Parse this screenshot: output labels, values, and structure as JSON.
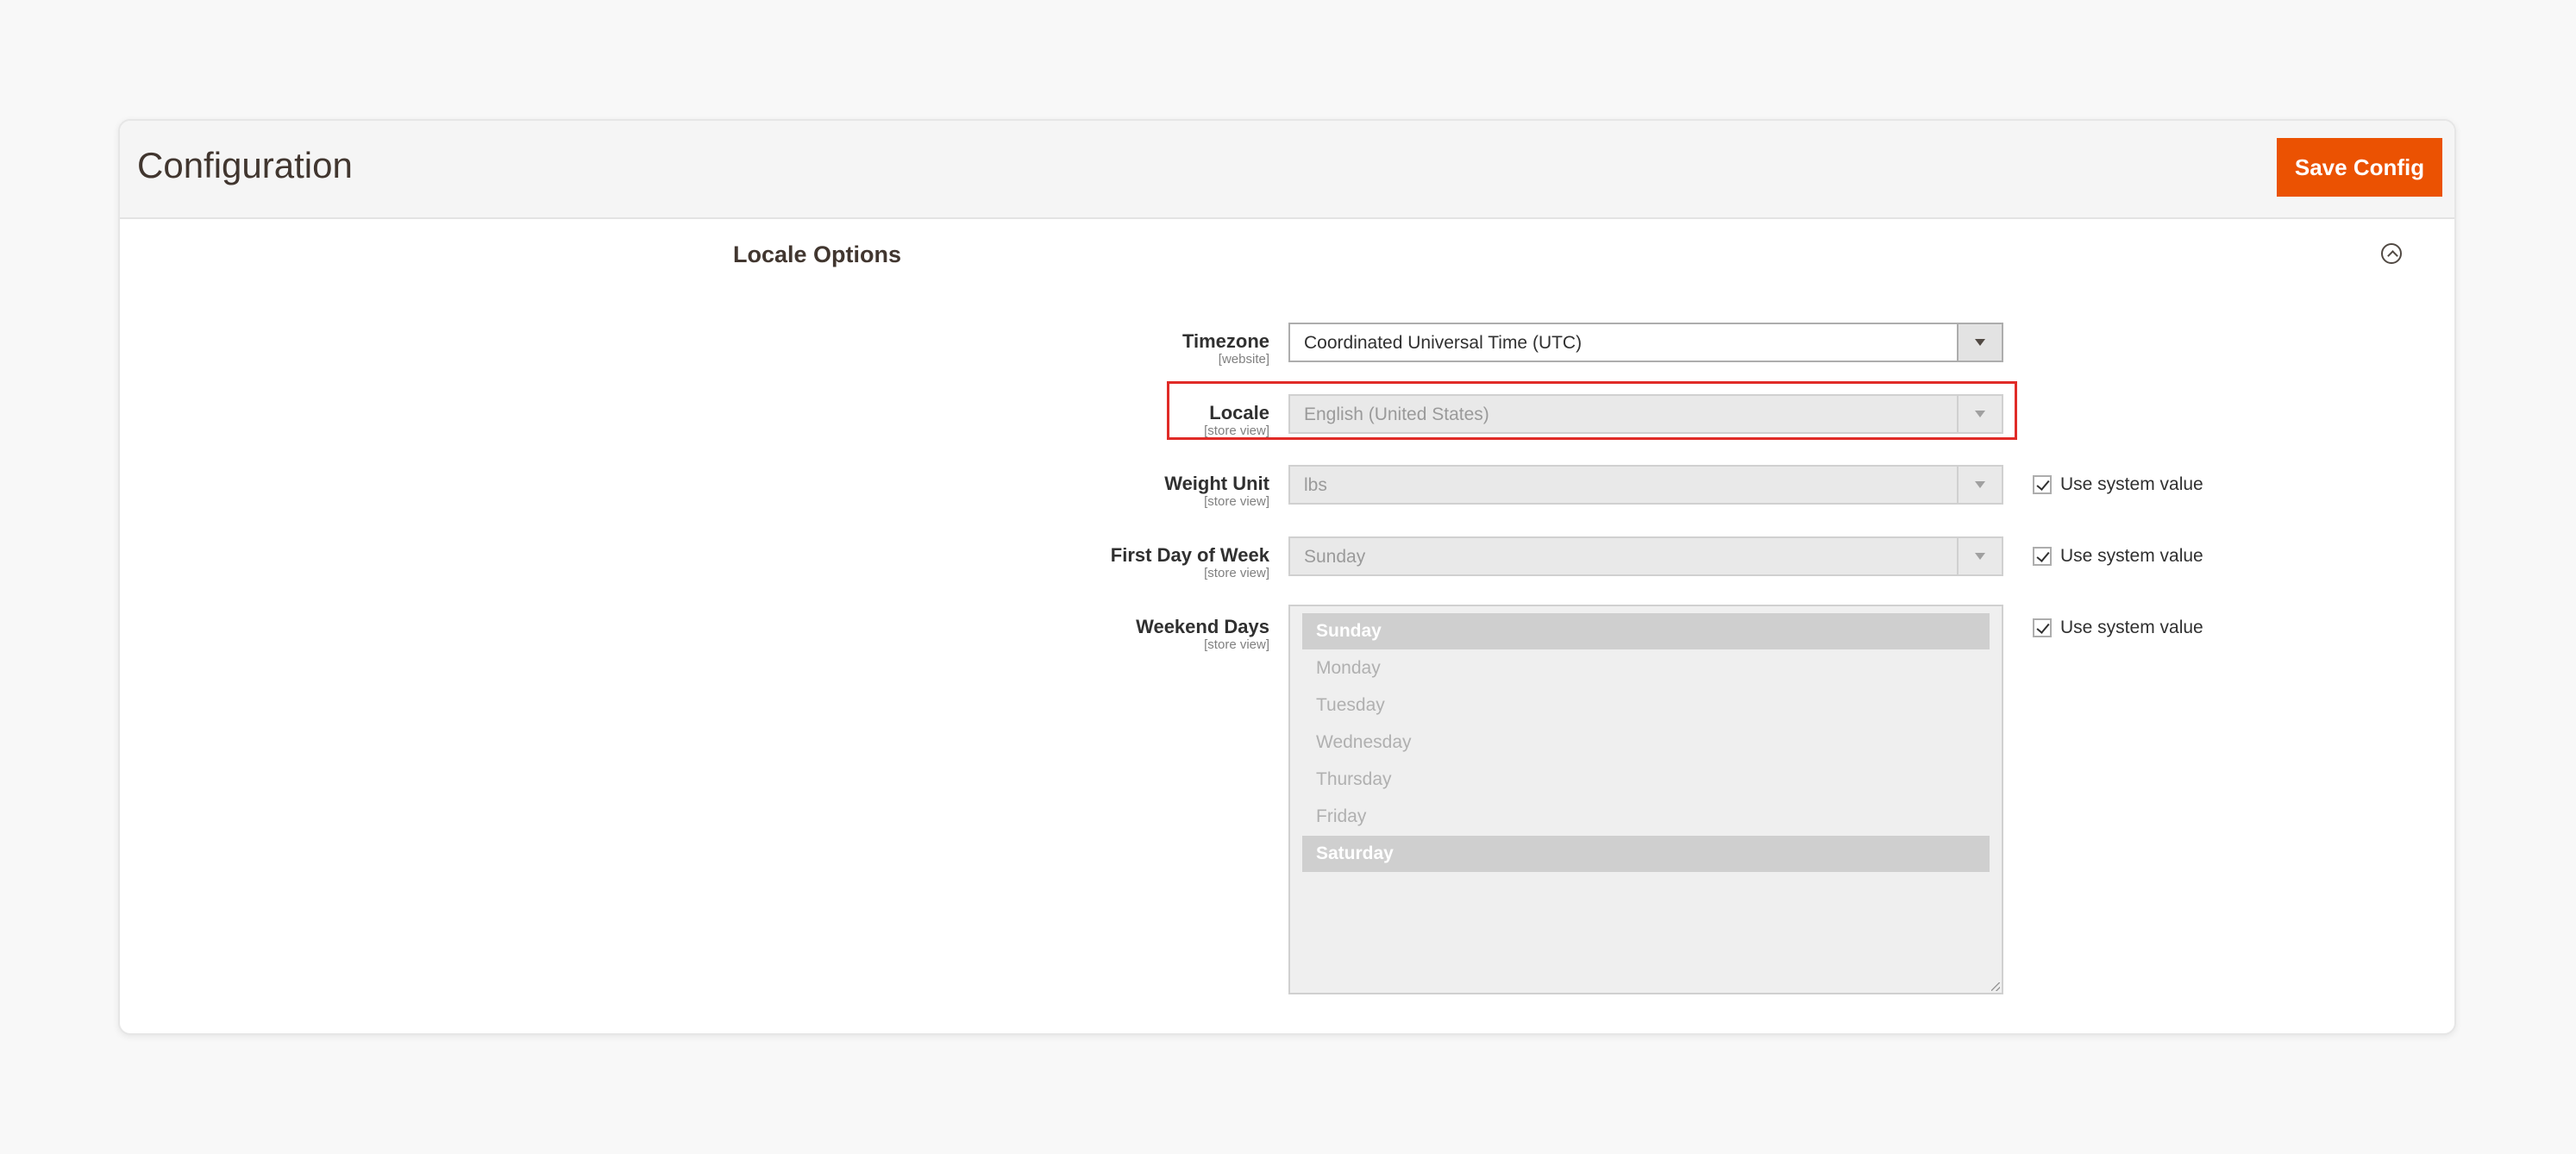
{
  "header": {
    "title": "Configuration",
    "save_label": "Save Config"
  },
  "section": {
    "title": "Locale Options"
  },
  "fields": {
    "timezone": {
      "label": "Timezone",
      "scope": "[website]",
      "value": "Coordinated Universal Time (UTC)"
    },
    "locale": {
      "label": "Locale",
      "scope": "[store view]",
      "value": "English (United States)"
    },
    "weight_unit": {
      "label": "Weight Unit",
      "scope": "[store view]",
      "value": "lbs",
      "use_system_label": "Use system value"
    },
    "first_day": {
      "label": "First Day of Week",
      "scope": "[store view]",
      "value": "Sunday",
      "use_system_label": "Use system value"
    },
    "weekend_days": {
      "label": "Weekend Days",
      "scope": "[store view]",
      "use_system_label": "Use system value",
      "options": [
        {
          "label": "Sunday",
          "selected": true
        },
        {
          "label": "Monday",
          "selected": false
        },
        {
          "label": "Tuesday",
          "selected": false
        },
        {
          "label": "Wednesday",
          "selected": false
        },
        {
          "label": "Thursday",
          "selected": false
        },
        {
          "label": "Friday",
          "selected": false
        },
        {
          "label": "Saturday",
          "selected": true
        }
      ]
    }
  },
  "colors": {
    "accent": "#eb5202",
    "highlight_border": "#e02b27"
  }
}
